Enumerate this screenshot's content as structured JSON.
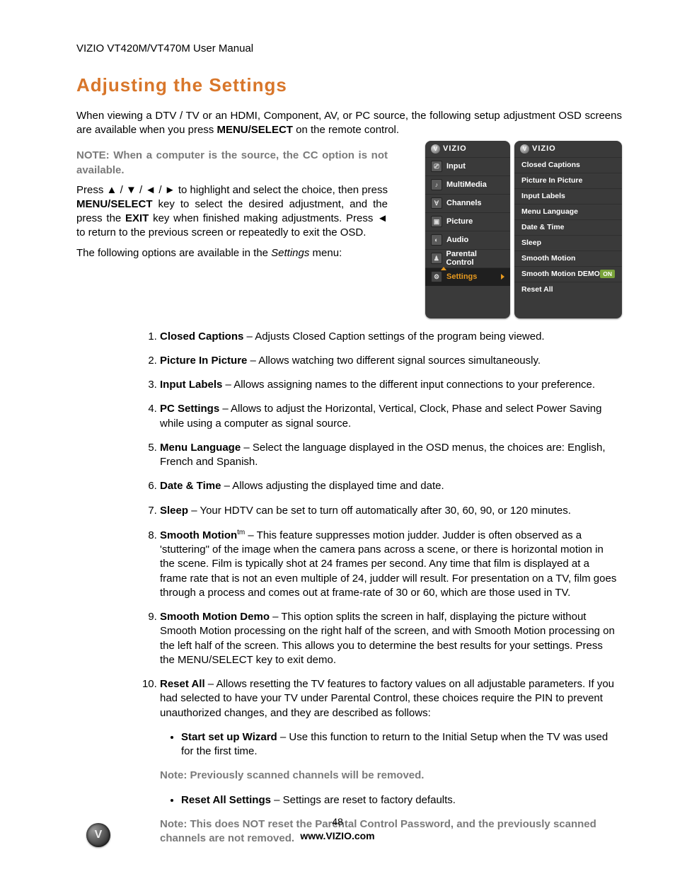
{
  "header": "VIZIO VT420M/VT470M User Manual",
  "title": "Adjusting the Settings",
  "intro1_a": "When viewing a DTV / TV or an HDMI, Component, AV, or PC source, the following setup adjustment OSD screens are available when you press ",
  "intro1_bold": "MENU/SELECT",
  "intro1_b": " on the remote control.",
  "note1": "NOTE: When a computer is the source, the CC option is not available.",
  "nav_a": "Press ",
  "nav_arrows": "▲ / ▼ / ◄ / ►",
  "nav_b": " to highlight and select the choice, then press ",
  "nav_bold1": "MENU/SELECT",
  "nav_c": " key to select the desired adjustment, and the press the ",
  "nav_bold2": "EXIT",
  "nav_d": " key when finished making adjustments. Press ",
  "nav_back": "◄",
  "nav_e": " to return to the previous screen or repeatedly to exit the OSD.",
  "intro2_a": "The following options are available in the ",
  "intro2_i": "Settings",
  "intro2_b": " menu:",
  "osd": {
    "brand": "VIZIO",
    "left": [
      "Input",
      "MultiMedia",
      "Channels",
      "Picture",
      "Audio",
      "Parental Control",
      "Settings"
    ],
    "left_icons": [
      "⎚",
      "♪",
      "∀",
      "▣",
      "◐",
      "♟",
      "⚙"
    ],
    "right": [
      "Closed Captions",
      "Picture In Picture",
      "Input Labels",
      "Menu Language",
      "Date & Time",
      "Sleep",
      "Smooth Motion",
      "Smooth Motion DEMO",
      "Reset All"
    ],
    "on": "ON"
  },
  "items": [
    {
      "t": "Closed Captions",
      "d": " – Adjusts Closed Caption settings of the program being viewed."
    },
    {
      "t": "Picture In Picture",
      "d": " – Allows watching two different signal sources simultaneously."
    },
    {
      "t": "Input Labels",
      "d": " – Allows assigning names to the different input connections to your preference."
    },
    {
      "t": "PC Settings",
      "d": " – Allows to adjust the Horizontal, Vertical, Clock, Phase and select Power Saving while using a computer as signal source."
    },
    {
      "t": "Menu Language",
      "d": " – Select the language displayed in the OSD menus, the choices are: English, French and Spanish."
    },
    {
      "t": "Date & Time",
      "d": " – Allows adjusting the displayed time and date."
    },
    {
      "t": "Sleep",
      "d": "  – Your HDTV can be set to turn off automatically after 30, 60, 90, or 120 minutes."
    },
    {
      "t": "Smooth Motion",
      "sup": "tm",
      "d": " – This feature suppresses motion judder. Judder is often observed as a 'stuttering\" of the image when the camera pans across a scene, or there is horizontal motion in the scene. Film is typically shot at 24 frames per second. Any time that film is displayed at a frame rate that is not an even multiple of 24, judder will result. For presentation on a TV, film goes through a process and comes out at frame-rate of 30 or 60, which are those used in TV."
    },
    {
      "t": "Smooth Motion Demo",
      "d": " – This option splits the screen in half, displaying the picture without Smooth Motion processing on the right half of the screen, and with Smooth Motion processing on the left half of the screen. This allows you to determine the best results for your settings. Press the MENU/SELECT key to exit demo."
    },
    {
      "t": "Reset All",
      "d": " – Allows resetting the TV features to factory values on all adjustable parameters. If you had selected to have your TV under Parental Control, these choices require the PIN to prevent unauthorized changes, and they are described as follows:"
    }
  ],
  "sub": [
    {
      "t": "Start set up Wizard",
      "d": " – Use this function to return to the Initial Setup when the TV was used for the first time."
    },
    {
      "note": "Note: Previously scanned channels will be removed."
    },
    {
      "t": "Reset All Settings",
      "d": " – Settings are reset to factory defaults."
    },
    {
      "note": "Note: This does NOT reset the Parental Control Password, and the previously scanned channels are not removed."
    }
  ],
  "footer": {
    "page": "48",
    "url": "www.VIZIO.com",
    "logo": "V"
  }
}
